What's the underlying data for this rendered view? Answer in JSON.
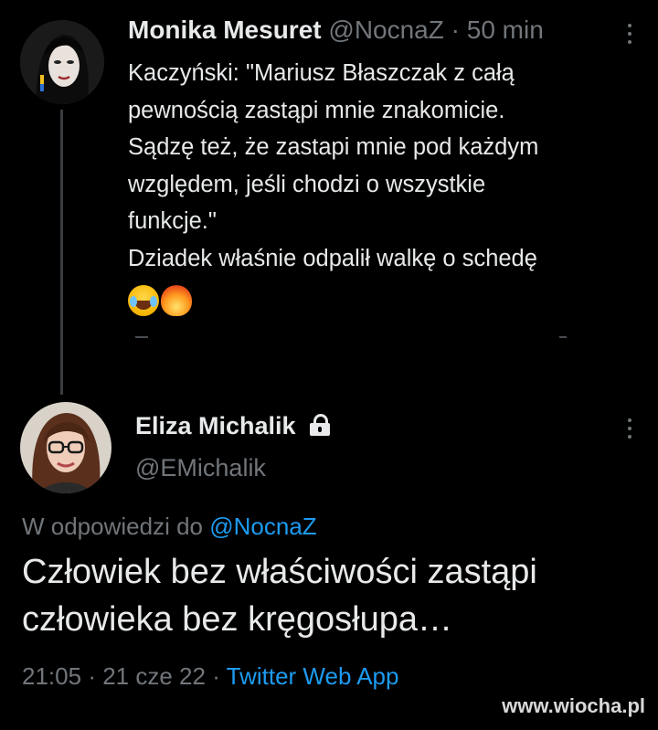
{
  "tweet1": {
    "author_name": "Monika Mesuret",
    "handle": "@NocnaZ",
    "separator": "·",
    "time": "50 min",
    "lines": [
      "Kaczyński: \"Mariusz Błaszczak z całą",
      "pewnością zastąpi mnie znakomicie.",
      "Sądzę też, że zastapi mnie pod każdym",
      "względem, jeśli chodzi o wszystkie",
      "funkcje.\"",
      "Dziadek właśnie odpalił walkę o schedę"
    ],
    "emojis": [
      "face-with-tears-of-joy-emoji",
      "fire-emoji"
    ]
  },
  "tweet2": {
    "author_name": "Eliza Michalik",
    "handle": "@EMichalik",
    "reply_prefix": "W odpowiedzi do",
    "reply_handle": "@NocnaZ",
    "text_lines": [
      "Człowiek bez właściwości zastąpi",
      "człowieka bez kręgosłupa…"
    ],
    "time": "21:05",
    "date": "21 cze 22",
    "separator": "·",
    "source": "Twitter Web App"
  },
  "watermark": "www.wiocha.pl",
  "colors": {
    "background": "#000000",
    "text": "#e7e9ea",
    "muted": "#71767b",
    "link": "#1d9bf0"
  }
}
